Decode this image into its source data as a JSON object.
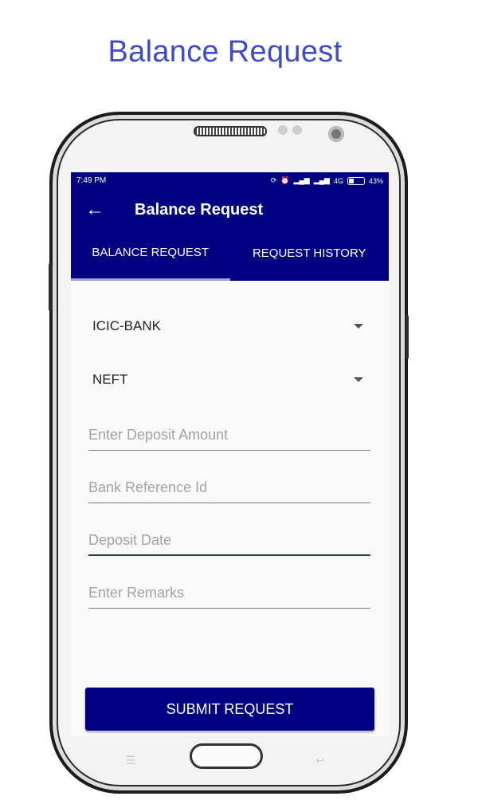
{
  "promo": {
    "title": "Balance Request"
  },
  "status_bar": {
    "time": "7:49 PM",
    "network": "4G",
    "battery": "43%"
  },
  "app_bar": {
    "title": "Balance Request"
  },
  "tabs": [
    {
      "label": "BALANCE REQUEST",
      "active": true
    },
    {
      "label": "REQUEST HISTORY",
      "active": false
    }
  ],
  "form": {
    "bank_select": {
      "value": "ICIC-BANK"
    },
    "mode_select": {
      "value": "NEFT"
    },
    "deposit_amount": {
      "placeholder": "Enter Deposit Amount"
    },
    "bank_reference": {
      "placeholder": "Bank Reference Id"
    },
    "deposit_date": {
      "placeholder": "Deposit Date"
    },
    "remarks": {
      "placeholder": "Enter Remarks"
    },
    "submit_label": "SUBMIT REQUEST"
  },
  "colors": {
    "primary": "#000080",
    "promo_title": "#3d4bc7"
  }
}
